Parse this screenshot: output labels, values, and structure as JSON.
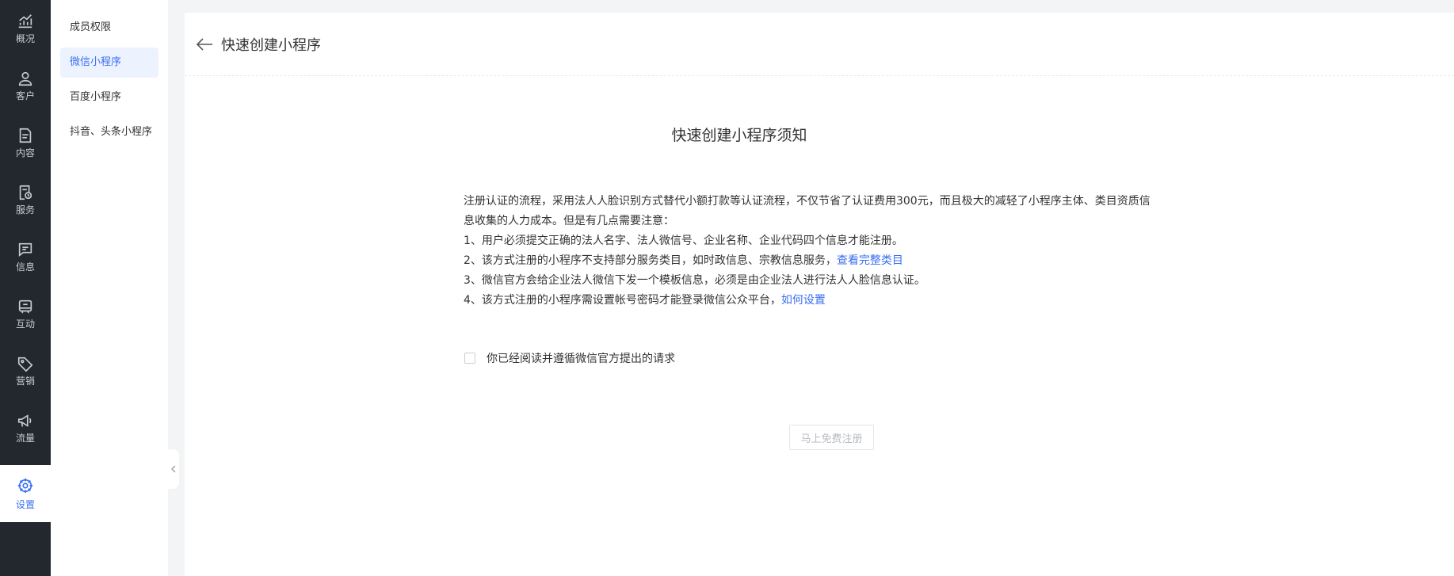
{
  "rail": {
    "items": [
      {
        "label": "概况",
        "icon": "trend-chart-icon"
      },
      {
        "label": "客户",
        "icon": "user-icon"
      },
      {
        "label": "内容",
        "icon": "document-icon"
      },
      {
        "label": "服务",
        "icon": "service-icon"
      },
      {
        "label": "信息",
        "icon": "message-icon"
      },
      {
        "label": "互动",
        "icon": "interact-icon"
      },
      {
        "label": "营销",
        "icon": "tag-icon"
      },
      {
        "label": "流量",
        "icon": "megaphone-icon"
      }
    ],
    "active": {
      "label": "设置",
      "icon": "settings-icon"
    }
  },
  "subnav": {
    "items": [
      {
        "label": "成员权限"
      },
      {
        "label": "微信小程序"
      },
      {
        "label": "百度小程序"
      },
      {
        "label": "抖音、头条小程序"
      }
    ]
  },
  "header": {
    "title": "快速创建小程序"
  },
  "notice": {
    "title": "快速创建小程序须知",
    "line1": "注册认证的流程，采用法人人脸识别方式替代小额打款等认证流程，不仅节省了认证费用300元，而且极大的减轻了小程序主体、类目资质信",
    "line2": "息收集的人力成本。但是有几点需要注意：",
    "item1": "1、用户必须提交正确的法人名字、法人微信号、企业名称、企业代码四个信息才能注册。",
    "item2": "2、该方式注册的小程序不支持部分服务类目，如时政信息、宗教信息服务，",
    "item2_link": "查看完整类目",
    "item3": "3、微信官方会给企业法人微信下发一个模板信息，必须是由企业法人进行法人人脸信息认证。",
    "item4": "4、该方式注册的小程序需设置帐号密码才能登录微信公众平台，",
    "item4_link": "如何设置"
  },
  "agree": {
    "label": "你已经阅读并遵循微信官方提出的请求",
    "checked": false
  },
  "register": {
    "label": "马上免费注册"
  },
  "colors": {
    "accent": "#3a6ff2",
    "rail_bg": "#23272e",
    "page_bg": "#f3f4f6"
  }
}
